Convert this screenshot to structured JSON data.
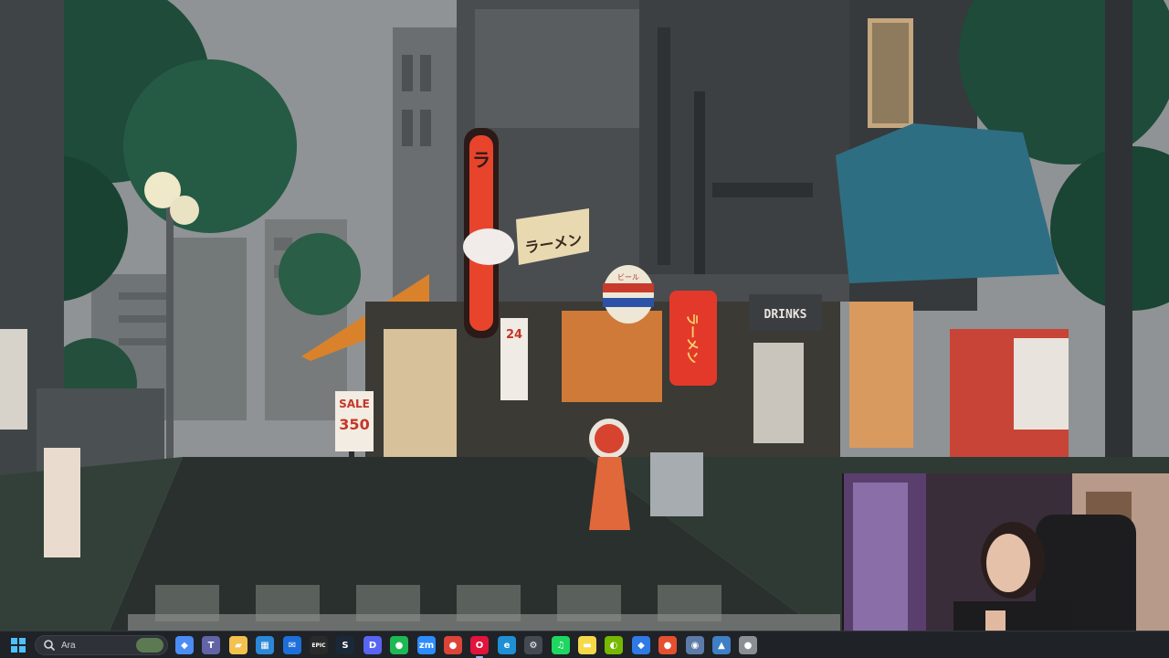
{
  "wallpaper": {
    "description_free": true,
    "signs": {
      "ramen_vertical": "ラ",
      "ramen_banner": "ラーメン",
      "ramen_lantern": "ラーメン",
      "beer_lantern": "ビール",
      "drinks": "DRINKS",
      "sale_top": "SALE",
      "sale_number": "350",
      "open24": "24"
    }
  },
  "taskbar": {
    "search_placeholder": "Ara",
    "icons": [
      {
        "name": "copilot-icon",
        "color": "#4b8cf5",
        "glyph": "◆"
      },
      {
        "name": "teams-icon",
        "color": "#6264a7",
        "glyph": "T"
      },
      {
        "name": "file-explorer-icon",
        "color": "#f2c14e",
        "glyph": "▰"
      },
      {
        "name": "store-icon",
        "color": "#2b88d8",
        "glyph": "▦"
      },
      {
        "name": "mail-icon",
        "color": "#1e6fd9",
        "glyph": "✉"
      },
      {
        "name": "epic-games-icon",
        "color": "#2a2a2a",
        "glyph": "EPIC"
      },
      {
        "name": "steam-icon",
        "color": "#1b2838",
        "glyph": "S"
      },
      {
        "name": "discord-icon",
        "color": "#5865f2",
        "glyph": "D"
      },
      {
        "name": "app-green-icon",
        "color": "#1db954",
        "glyph": "●"
      },
      {
        "name": "zoom-icon",
        "color": "#2d8cff",
        "glyph": "zm"
      },
      {
        "name": "chrome-icon",
        "color": "#db4437",
        "glyph": "●"
      },
      {
        "name": "opera-gx-icon",
        "color": "#e0143c",
        "glyph": "O"
      },
      {
        "name": "edge-icon",
        "color": "#1f8fd6",
        "glyph": "e"
      },
      {
        "name": "settings-icon",
        "color": "#444a52",
        "glyph": "⚙"
      },
      {
        "name": "spotify-icon",
        "color": "#1ed760",
        "glyph": "♫"
      },
      {
        "name": "sticky-notes-icon",
        "color": "#f5d94a",
        "glyph": "▬"
      },
      {
        "name": "nvidia-icon",
        "color": "#76b900",
        "glyph": "◐"
      },
      {
        "name": "app-blue-icon",
        "color": "#2f7ae5",
        "glyph": "◆"
      },
      {
        "name": "app-red-icon",
        "color": "#e5502f",
        "glyph": "●"
      },
      {
        "name": "app-gray-icon",
        "color": "#5d7ba8",
        "glyph": "◉"
      },
      {
        "name": "photos-icon",
        "color": "#3f7fc4",
        "glyph": "▲"
      },
      {
        "name": "notification-app-icon",
        "color": "#8a8f96",
        "glyph": "●"
      }
    ]
  },
  "colors": {
    "sky": "#8d9194",
    "road": "#2a302d",
    "neon_red": "#e8442b",
    "awning_orange": "#d9822b",
    "tarp_blue": "#2e6e83",
    "tree_dark": "#1f4c3a"
  }
}
